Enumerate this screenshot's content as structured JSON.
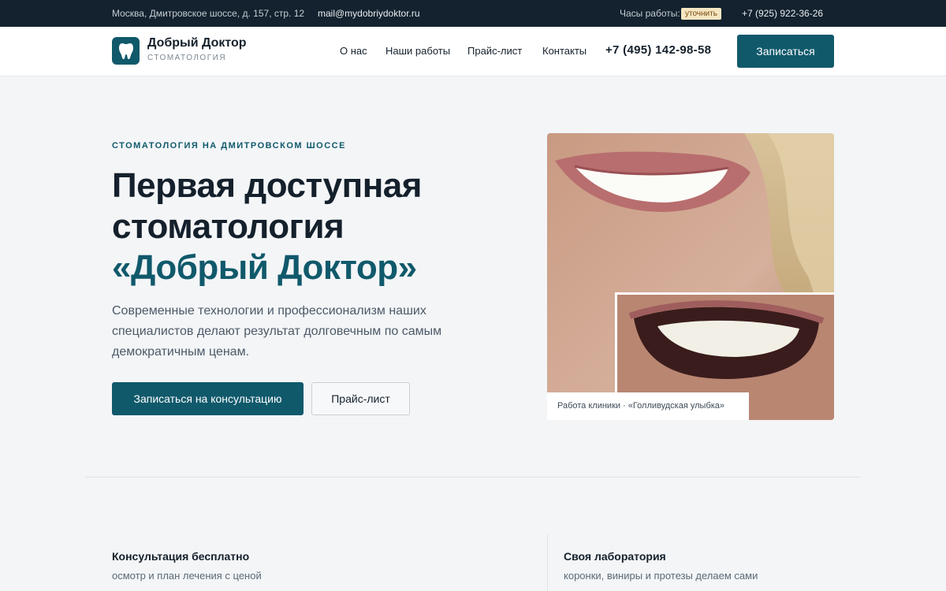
{
  "topbar": {
    "address": "Москва, Дмитровское шоссе, д. 157, стр. 12",
    "email": "mail@mydobriydoktor.ru",
    "hours_label": "Часы работы:",
    "hours_badge": "уточнить",
    "phone": "+7 (925) 922-36-26"
  },
  "header": {
    "logo_title": "Добрый Доктор",
    "logo_subtitle": "СТОМАТОЛОГИЯ",
    "nav": [
      "О нас",
      "Наши работы",
      "Прайс-лист",
      "Контакты"
    ],
    "phone": "+7 (495) 142-98-58",
    "cta": "Записаться"
  },
  "hero": {
    "eyebrow": "СТОМАТОЛОГИЯ НА ДМИТРОВСКОМ ШОССЕ",
    "title_line1": "Первая доступная",
    "title_line2": "стоматология",
    "title_accent": "«Добрый Доктор»",
    "lead": "Современные технологии и профессионализм наших специалистов делают результат долговечным по самым демократичным ценам.",
    "primary_button": "Записаться на консультацию",
    "secondary_button": "Прайс-лист",
    "photo_caption": "Работа клиники · «Голливудская улыбка»"
  },
  "features": [
    {
      "title": "Консультация бесплатно",
      "desc": "осмотр и план лечения с ценой"
    },
    {
      "title": "Своя лаборатория",
      "desc": "коронки, виниры и протезы делаем сами"
    }
  ],
  "colors": {
    "brand": "#10596b",
    "topbar_bg": "#13222e",
    "page_bg": "#f3f5f7",
    "badge_bg": "#f6e6c2"
  }
}
